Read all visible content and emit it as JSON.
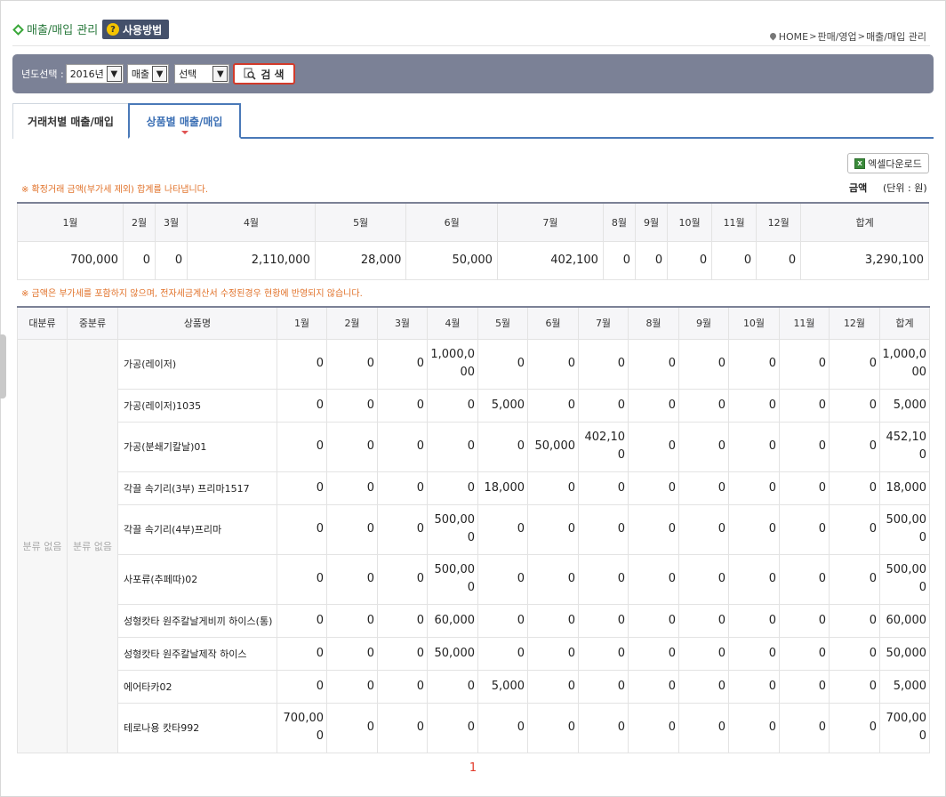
{
  "header": {
    "title": "매출/매입 관리",
    "usage_button": "사용방법",
    "breadcrumb": [
      "HOME",
      "판매/영업",
      "매출/매입 관리"
    ]
  },
  "search": {
    "year_label": "년도선택 :",
    "year_value": "2016년",
    "type_value": "매출",
    "select_value": "선택",
    "search_button": "검 색"
  },
  "tabs": [
    {
      "label": "거래처별 매출/매입",
      "active": false
    },
    {
      "label": "상품별 매출/매입",
      "active": true
    }
  ],
  "excel_button": "엑셀다운로드",
  "notes": {
    "note1": "※ 확정거래 금액(부가세 제외) 합계를 나타냅니다.",
    "amount_label": "금액",
    "unit_label": "(단위 : 원)",
    "note2": "※ 금액은 부가세를 포함하지 않으며, 전자세금계산서 수정된경우 현황에 반영되지 않습니다."
  },
  "summary": {
    "headers": [
      "1월",
      "2월",
      "3월",
      "4월",
      "5월",
      "6월",
      "7월",
      "8월",
      "9월",
      "10월",
      "11월",
      "12월",
      "합계"
    ],
    "values": [
      "700,000",
      "0",
      "0",
      "2,110,000",
      "28,000",
      "50,000",
      "402,100",
      "0",
      "0",
      "0",
      "0",
      "0",
      "3,290,100"
    ]
  },
  "detail": {
    "headers": [
      "대분류",
      "중분류",
      "상품명",
      "1월",
      "2월",
      "3월",
      "4월",
      "5월",
      "6월",
      "7월",
      "8월",
      "9월",
      "10월",
      "11월",
      "12월",
      "합계"
    ],
    "category_main": "분류 없음",
    "category_sub": "분류 없음",
    "rows": [
      {
        "name": "가공(레이저)",
        "tall": true,
        "values": [
          "0",
          "0",
          "0",
          "1,000,000",
          "0",
          "0",
          "0",
          "0",
          "0",
          "0",
          "0",
          "0",
          "1,000,000"
        ]
      },
      {
        "name": "가공(레이저)1035",
        "tall": false,
        "values": [
          "0",
          "0",
          "0",
          "0",
          "5,000",
          "0",
          "0",
          "0",
          "0",
          "0",
          "0",
          "0",
          "5,000"
        ]
      },
      {
        "name": "가공(분쇄기칼날)01",
        "tall": true,
        "values": [
          "0",
          "0",
          "0",
          "0",
          "0",
          "50,000",
          "402,100",
          "0",
          "0",
          "0",
          "0",
          "0",
          "452,100"
        ]
      },
      {
        "name": "각끌 속기리(3부) 프리마1517",
        "tall": false,
        "values": [
          "0",
          "0",
          "0",
          "0",
          "18,000",
          "0",
          "0",
          "0",
          "0",
          "0",
          "0",
          "0",
          "18,000"
        ]
      },
      {
        "name": "각끌 속기리(4부)프리마",
        "tall": true,
        "values": [
          "0",
          "0",
          "0",
          "500,000",
          "0",
          "0",
          "0",
          "0",
          "0",
          "0",
          "0",
          "0",
          "500,000"
        ]
      },
      {
        "name": "사포류(추페따)02",
        "tall": true,
        "values": [
          "0",
          "0",
          "0",
          "500,000",
          "0",
          "0",
          "0",
          "0",
          "0",
          "0",
          "0",
          "0",
          "500,000"
        ]
      },
      {
        "name": "성형캇타 원주칼날게비끼 하이스(통)",
        "tall": false,
        "values": [
          "0",
          "0",
          "0",
          "60,000",
          "0",
          "0",
          "0",
          "0",
          "0",
          "0",
          "0",
          "0",
          "60,000"
        ]
      },
      {
        "name": "성형캇타 원주칼날제작 하이스",
        "tall": false,
        "values": [
          "0",
          "0",
          "0",
          "50,000",
          "0",
          "0",
          "0",
          "0",
          "0",
          "0",
          "0",
          "0",
          "50,000"
        ]
      },
      {
        "name": "에어타카02",
        "tall": false,
        "values": [
          "0",
          "0",
          "0",
          "0",
          "5,000",
          "0",
          "0",
          "0",
          "0",
          "0",
          "0",
          "0",
          "5,000"
        ]
      },
      {
        "name": "테로나용 캇타992",
        "tall": true,
        "values": [
          "700,000",
          "0",
          "0",
          "0",
          "0",
          "0",
          "0",
          "0",
          "0",
          "0",
          "0",
          "0",
          "700,000"
        ]
      }
    ]
  },
  "pagination": {
    "current": "1"
  }
}
